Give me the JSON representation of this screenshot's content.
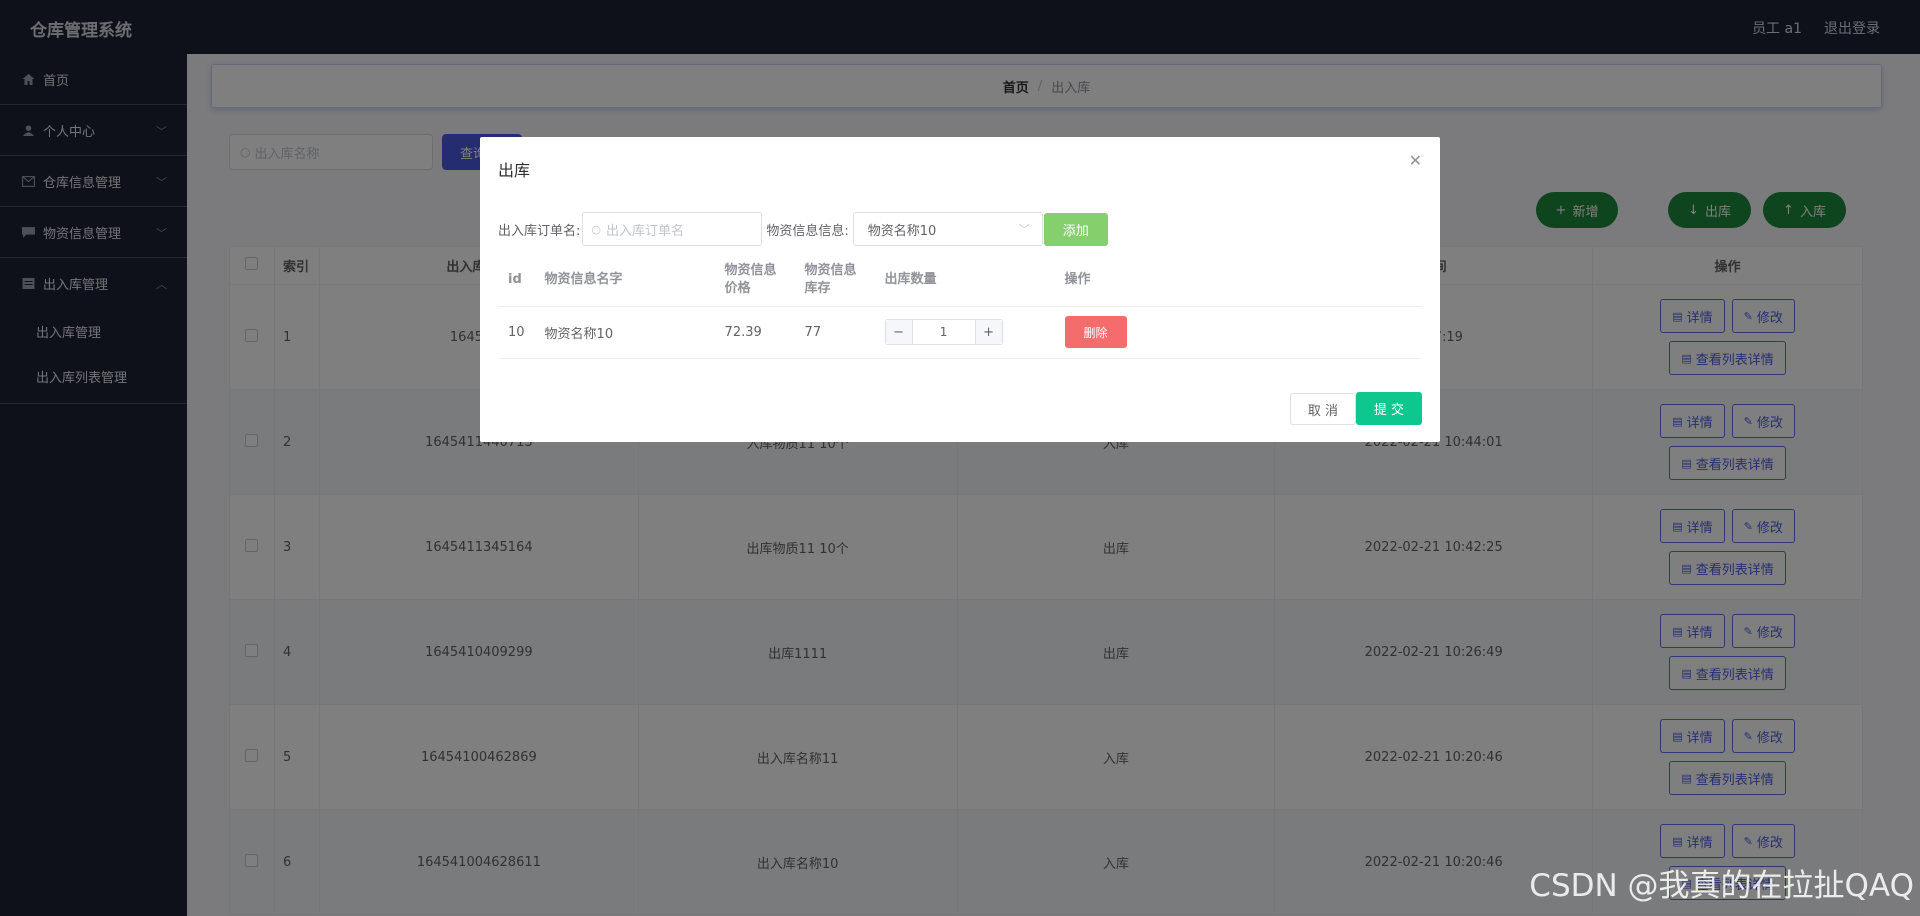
{
  "app": {
    "title": "仓库管理系统",
    "user": "员工 a1",
    "logout": "退出登录"
  },
  "sidebar": {
    "items": [
      {
        "label": "首页",
        "icon": "home-icon"
      },
      {
        "label": "个人中心",
        "icon": "user-icon"
      },
      {
        "label": "仓库信息管理",
        "icon": "mail-icon"
      },
      {
        "label": "物资信息管理",
        "icon": "chat-icon"
      },
      {
        "label": "出入库管理",
        "icon": "doc-icon"
      }
    ],
    "subitems": [
      {
        "label": "出入库管理"
      },
      {
        "label": "出入库列表管理"
      }
    ]
  },
  "breadcrumb": {
    "home": "首页",
    "separator": "/",
    "current": "出入库"
  },
  "toolbar": {
    "search_placeholder": "出入库名称",
    "query_label": "查询",
    "add_label": "新增",
    "out_label": "出库",
    "in_label": "入库"
  },
  "table": {
    "headers": {
      "index": "索引",
      "no": "出入库编号",
      "time": "时间",
      "ops": "操作"
    },
    "rows": [
      {
        "idx": "1",
        "no": "1645603",
        "name": "",
        "type": "",
        "time": "15:57:19"
      },
      {
        "idx": "2",
        "no": "1645411440713",
        "name": "入库物质11 10个",
        "type": "入库",
        "time": "2022-02-21 10:44:01"
      },
      {
        "idx": "3",
        "no": "1645411345164",
        "name": "出库物质11 10个",
        "type": "出库",
        "time": "2022-02-21 10:42:25"
      },
      {
        "idx": "4",
        "no": "1645410409299",
        "name": "出库1111",
        "type": "出库",
        "time": "2022-02-21 10:26:49"
      },
      {
        "idx": "5",
        "no": "16454100462869",
        "name": "出入库名称11",
        "type": "入库",
        "time": "2022-02-21 10:20:46"
      },
      {
        "idx": "6",
        "no": "164541004628611",
        "name": "出入库名称10",
        "type": "入库",
        "time": "2022-02-21 10:20:46"
      }
    ],
    "op_detail": "详情",
    "op_edit": "修改",
    "op_list": "查看列表详情"
  },
  "dialog": {
    "title": "出库",
    "order_label": "出入库订单名:",
    "order_placeholder": "出入库订单名",
    "material_label": "物资信息信息:",
    "material_selected": "物资名称10",
    "add_label": "添加",
    "headers": {
      "id": "id",
      "name": "物资信息名字",
      "price": "物资信息价格",
      "stock": "物资信息库存",
      "qty": "出库数量",
      "ops": "操作"
    },
    "rows": [
      {
        "id": "10",
        "name": "物资名称10",
        "price": "72.39",
        "stock": "77",
        "qty": "1"
      }
    ],
    "delete_label": "删除",
    "cancel_label": "取 消",
    "submit_label": "提 交"
  },
  "watermark": "CSDN @我真的在拉扯QAQ"
}
